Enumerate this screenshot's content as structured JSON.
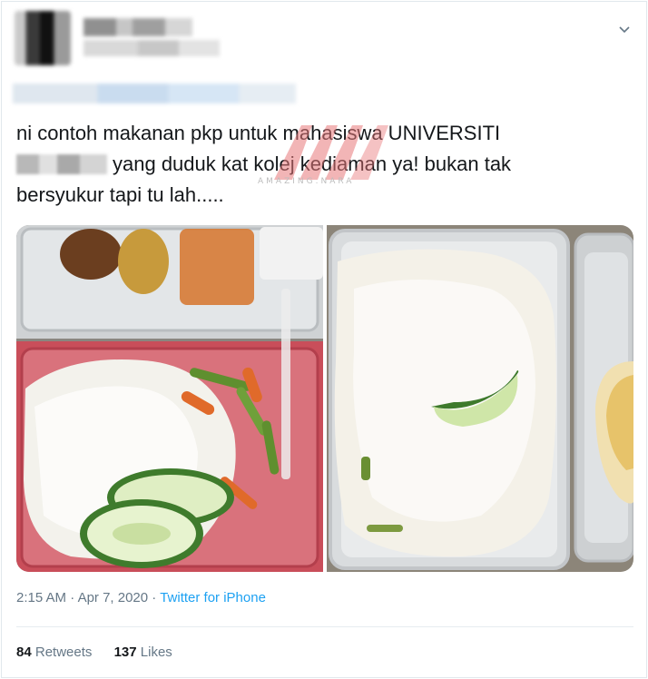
{
  "tweet": {
    "text_line1": "ni contoh makanan pkp untuk mahasiswa UNIVERSITI",
    "text_line2": "yang duduk kat kolej kediaman ya! bukan tak",
    "text_line3": "bersyukur tapi tu lah.....",
    "watermark": "AMAZING.NARA",
    "time": "2:15 AM",
    "date": "Apr 7, 2020",
    "separator": "·",
    "source": "Twitter for iPhone",
    "retweets_count": "84",
    "retweets_label": "Retweets",
    "likes_count": "137",
    "likes_label": "Likes"
  },
  "icons": {
    "menu": "chevron-down-icon"
  },
  "colors": {
    "link": "#1da1f2",
    "meta": "#657786",
    "text": "#14171a",
    "watermark": "#e8787a"
  }
}
